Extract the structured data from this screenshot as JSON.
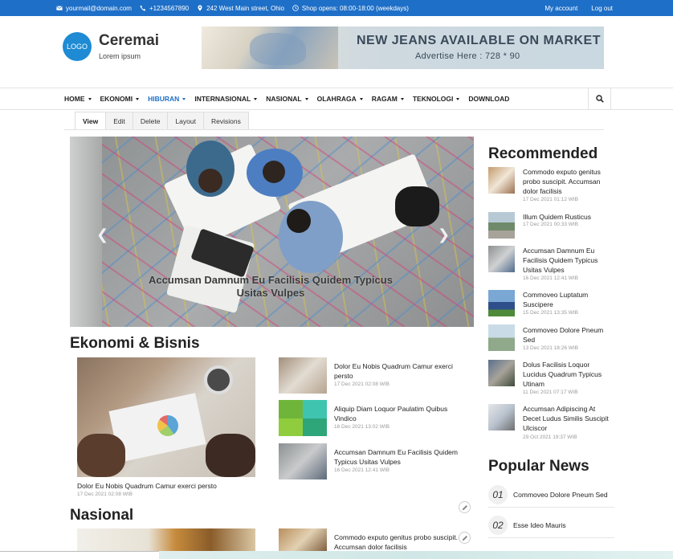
{
  "topbar": {
    "email": "yourmail@domain.com",
    "phone": "+1234567890",
    "address": "242 West Main street, Ohio",
    "hours": "Shop opens: 08:00-18:00 (weekdays)",
    "my_account": "My account",
    "logout": "Log out",
    "color": "#1e6fc7"
  },
  "header": {
    "logo": "LOGO",
    "site_name": "Ceremai",
    "slogan": "Lorem ipsum",
    "banner_title": "NEW JEANS AVAILABLE ON MARKET",
    "banner_sub": "Advertise Here : 728 * 90"
  },
  "nav": {
    "items": [
      {
        "label": "HOME",
        "dropdown": true
      },
      {
        "label": "EKONOMI",
        "dropdown": true
      },
      {
        "label": "HIBURAN",
        "dropdown": true,
        "active": true
      },
      {
        "label": "INTERNASIONAL",
        "dropdown": true
      },
      {
        "label": "NASIONAL",
        "dropdown": true
      },
      {
        "label": "OLAHRAGA",
        "dropdown": true
      },
      {
        "label": "RAGAM",
        "dropdown": true
      },
      {
        "label": "TEKNOLOGI",
        "dropdown": true
      },
      {
        "label": "DOWNLOAD",
        "dropdown": false
      }
    ]
  },
  "tabs": [
    "View",
    "Edit",
    "Delete",
    "Layout",
    "Revisions"
  ],
  "slider": {
    "caption": "Accumsan Damnum Eu Facilisis Quidem Typicus Usitas Vulpes"
  },
  "ekonomi": {
    "title": "Ekonomi & Bisnis",
    "main_title": "Dolor Eu Nobis Quadrum Camur exerci persto",
    "main_date": "17 Dec 2021 02:08 WIB",
    "list": [
      {
        "title": "Dolor Eu Nobis Quadrum Camur exerci persto",
        "date": "17 Dec 2021 02:08 WIB"
      },
      {
        "title": "Aliquip Diam Loquor Paulatim Quibus Vindico",
        "date": "16 Dec 2021 13:02 WIB"
      },
      {
        "title": "Accumsan Damnum Eu Facilisis Quidem Typicus Usitas Vulpes",
        "date": "16 Dec 2021 12:41 WIB"
      }
    ]
  },
  "nasional": {
    "title": "Nasional",
    "list": [
      {
        "title": "Commodo exputo genitus probo suscipit. Accumsan dolor facilisis"
      }
    ]
  },
  "recommended": {
    "title": "Recommended",
    "items": [
      {
        "title": "Commodo exputo genitus probo suscipit. Accumsan dolor facilisis",
        "date": "17 Dec 2021 01:12 WIB"
      },
      {
        "title": "Illum Quidem Rusticus",
        "date": "17 Dec 2021 00:33 WIB"
      },
      {
        "title": "Accumsan Damnum Eu Facilisis Quidem Typicus Usitas Vulpes",
        "date": "16 Dec 2021 12:41 WIB"
      },
      {
        "title": "Commoveo Luptatum Suscipere",
        "date": "15 Dec 2021 13:35 WIB"
      },
      {
        "title": "Commoveo Dolore Pneum Sed",
        "date": "13 Dec 2021 18:26 WIB"
      },
      {
        "title": "Dolus Facilisis Loquor Lucidus Quadrum Typicus Utinam",
        "date": "11 Dec 2021 07:17 WIB"
      },
      {
        "title": "Accumsan Adipiscing At Decet Ludus Similis Suscipit Ulciscor",
        "date": "29 Oct 2021 19:37 WIB"
      }
    ]
  },
  "popular": {
    "title": "Popular News",
    "items": [
      {
        "num": "01",
        "title": "Commoveo Dolore Pneum Sed"
      },
      {
        "num": "02",
        "title": "Esse Ideo Mauris"
      }
    ]
  }
}
